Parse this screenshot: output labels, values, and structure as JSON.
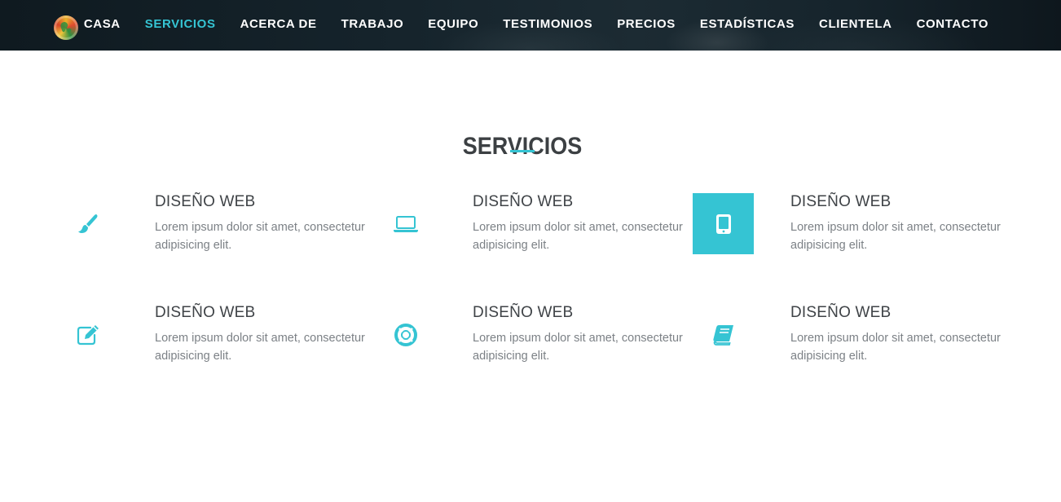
{
  "nav": {
    "logo": "globe-logo",
    "items": [
      {
        "label": "CASA",
        "active": false
      },
      {
        "label": "SERVICIOS",
        "active": true
      },
      {
        "label": "ACERCA DE",
        "active": false
      },
      {
        "label": "TRABAJO",
        "active": false
      },
      {
        "label": "EQUIPO",
        "active": false
      },
      {
        "label": "TESTIMONIOS",
        "active": false
      },
      {
        "label": "PRECIOS",
        "active": false
      },
      {
        "label": "ESTADÍSTICAS",
        "active": false
      },
      {
        "label": "CLIENTELA",
        "active": false
      },
      {
        "label": "CONTACTO",
        "active": false
      }
    ]
  },
  "services": {
    "title": "SERVICIOS",
    "accent_color": "#35c4d3",
    "items": [
      {
        "icon": "paint-brush-icon",
        "title": "DISEÑO WEB",
        "text": "Lorem ipsum dolor sit amet, consectetur adipisicing elit."
      },
      {
        "icon": "laptop-icon",
        "title": "DISEÑO WEB",
        "text": "Lorem ipsum dolor sit amet, consectetur adipisicing elit."
      },
      {
        "icon": "tablet-icon",
        "title": "DISEÑO WEB",
        "text": "Lorem ipsum dolor sit amet, consectetur adipisicing elit."
      },
      {
        "icon": "edit-icon",
        "title": "DISEÑO WEB",
        "text": "Lorem ipsum dolor sit amet, consectetur adipisicing elit."
      },
      {
        "icon": "life-ring-icon",
        "title": "DISEÑO WEB",
        "text": "Lorem ipsum dolor sit amet, consectetur adipisicing elit."
      },
      {
        "icon": "book-icon",
        "title": "DISEÑO WEB",
        "text": "Lorem ipsum dolor sit amet, consectetur adipisicing elit."
      }
    ]
  }
}
